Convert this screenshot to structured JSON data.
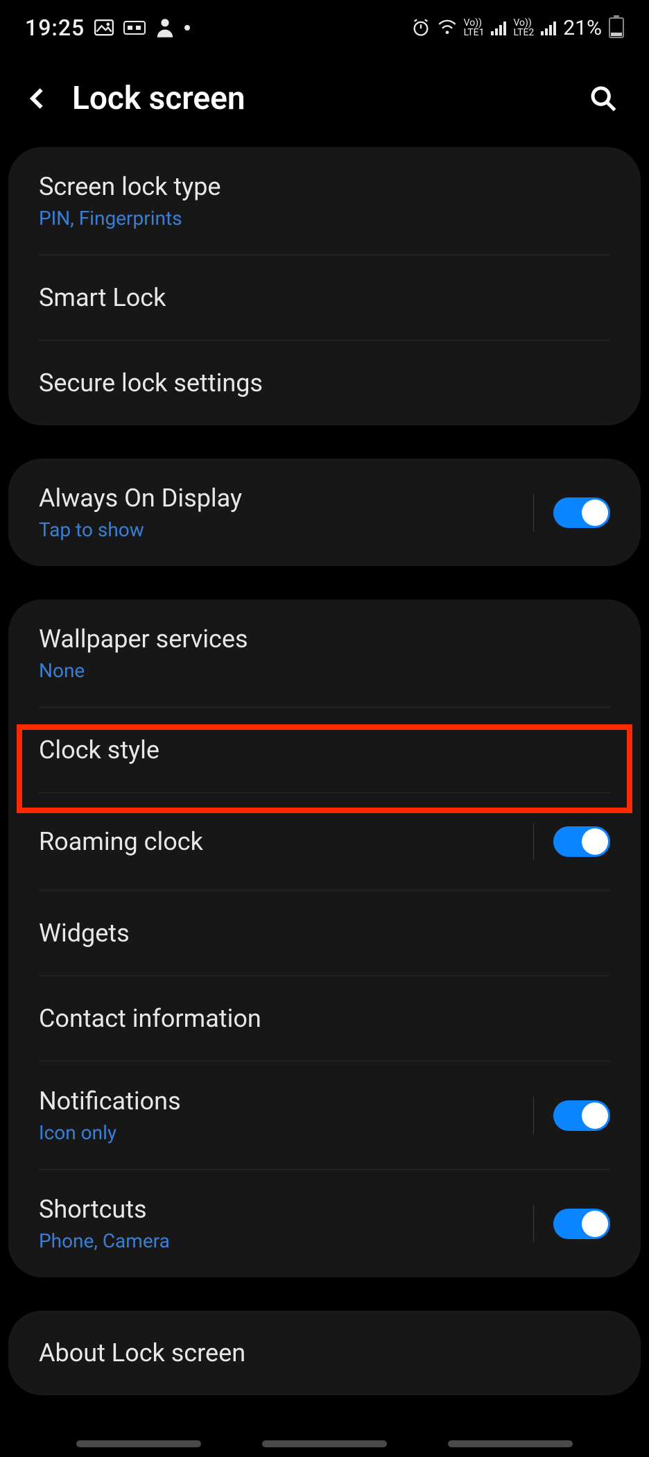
{
  "status": {
    "time": "19:25",
    "lte1": "LTE1",
    "lte2": "LTE2",
    "vo": "Vo))",
    "battery_pct": "21%"
  },
  "header": {
    "title": "Lock screen"
  },
  "group1": {
    "screen_lock_type": {
      "title": "Screen lock type",
      "sub": "PIN, Fingerprints"
    },
    "smart_lock": {
      "title": "Smart Lock"
    },
    "secure_lock": {
      "title": "Secure lock settings"
    }
  },
  "group2": {
    "aod": {
      "title": "Always On Display",
      "sub": "Tap to show"
    }
  },
  "group3": {
    "wallpaper": {
      "title": "Wallpaper services",
      "sub": "None"
    },
    "clock_style": {
      "title": "Clock style"
    },
    "roaming_clock": {
      "title": "Roaming clock"
    },
    "widgets": {
      "title": "Widgets"
    },
    "contact_info": {
      "title": "Contact information"
    },
    "notifications": {
      "title": "Notifications",
      "sub": "Icon only"
    },
    "shortcuts": {
      "title": "Shortcuts",
      "sub": "Phone, Camera"
    }
  },
  "group4": {
    "about": {
      "title": "About Lock screen"
    }
  }
}
